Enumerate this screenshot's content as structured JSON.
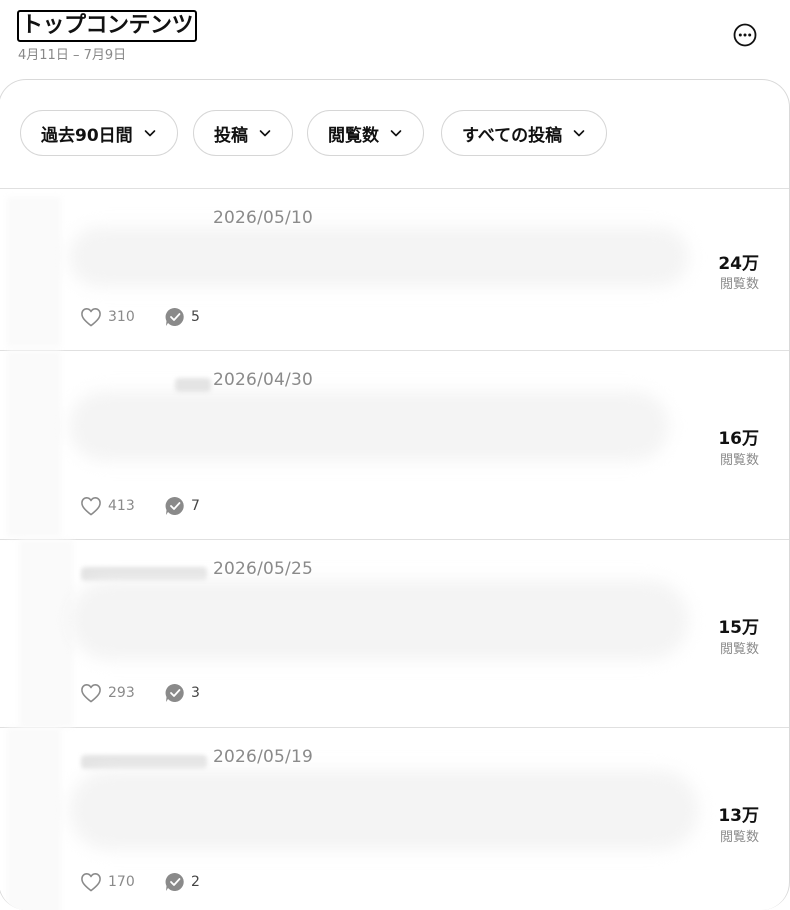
{
  "header": {
    "title": "トップコンテンツ",
    "date_range": "4月11日 – 7月9日",
    "more_icon": "more-horizontal-icon"
  },
  "filters": [
    {
      "label": "過去90日間",
      "icon": "chevron-down-icon"
    },
    {
      "label": "投稿",
      "icon": "chevron-down-icon"
    },
    {
      "label": "閲覧数",
      "icon": "chevron-down-icon"
    },
    {
      "label": "すべての投稿",
      "icon": "chevron-down-icon"
    }
  ],
  "posts": [
    {
      "date": "2026/05/10",
      "views": "24万",
      "views_label": "閲覧数",
      "likes": "310",
      "replies": "5"
    },
    {
      "date": "2026/04/30",
      "views": "16万",
      "views_label": "閲覧数",
      "likes": "413",
      "replies": "7"
    },
    {
      "date": "2026/05/25",
      "views": "15万",
      "views_label": "閲覧数",
      "likes": "293",
      "replies": "3"
    },
    {
      "date": "2026/05/19",
      "views": "13万",
      "views_label": "閲覧数",
      "likes": "170",
      "replies": "2"
    }
  ],
  "colors": {
    "muted": "#8a8a8a",
    "border": "#e0e0e0",
    "text": "#111111"
  }
}
